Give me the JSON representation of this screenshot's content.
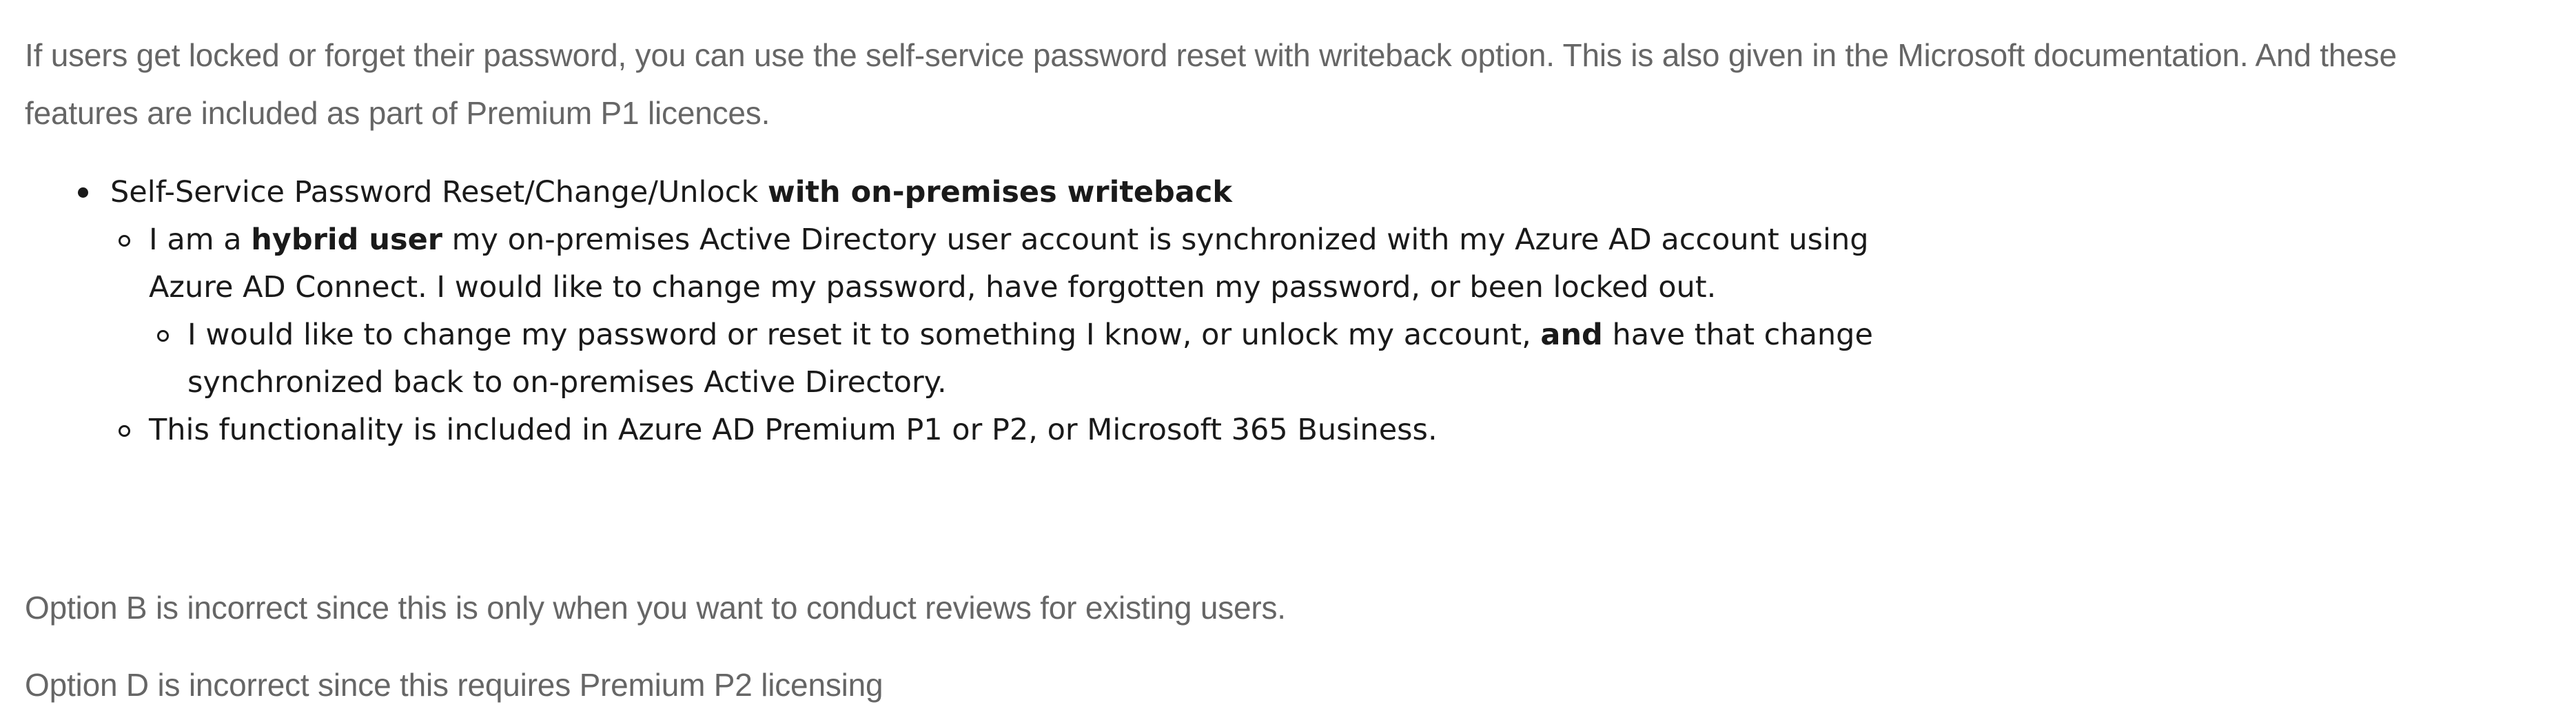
{
  "intro": {
    "line1": "If users get locked or forget their password, you can use the self-service password reset with writeback option. This is also given in the Microsoft documentation. And these",
    "line2": "features are included as part of Premium P1 licences."
  },
  "quote": {
    "item1": {
      "text": "Self-Service Password Reset/Change/Unlock ",
      "bold": "with on-premises writeback"
    },
    "item1a": {
      "pre": "I am a ",
      "bold": "hybrid user",
      "post": " my on-premises Active Directory user account is synchronized with my Azure AD account using",
      "line2": "Azure AD Connect. I would like to change my password, have forgotten my password, or been locked out."
    },
    "item1a_i": {
      "pre": "I would like to change my password or reset it to something I know, or unlock my account, ",
      "bold": "and",
      "post": " have that change",
      "line2": "synchronized back to on-premises Active Directory."
    },
    "item1b": {
      "text": "This functionality is included in Azure AD Premium P1 or P2, or Microsoft 365 Business."
    }
  },
  "options": {
    "b": "Option B is incorrect since this is only when you want to conduct reviews for existing users.",
    "d": "Option D is incorrect since this requires Premium P2 licensing"
  }
}
